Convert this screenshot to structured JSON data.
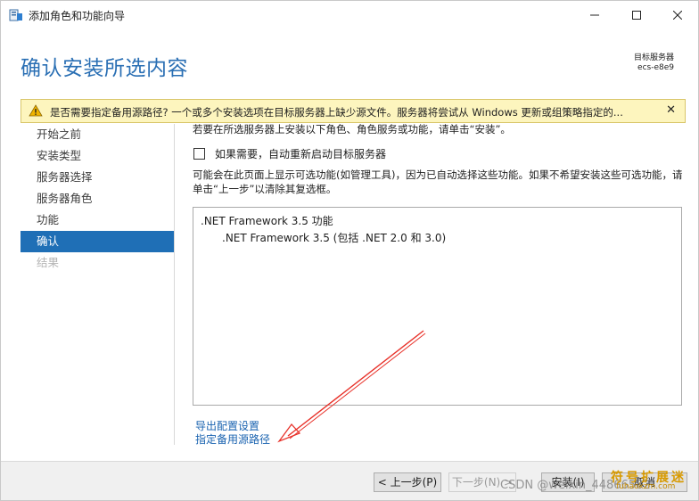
{
  "window": {
    "title": "添加角色和功能向导"
  },
  "header": {
    "page_title": "确认安装所选内容",
    "target_label": "目标服务器",
    "target_value": "ecs-e8e9"
  },
  "warning": {
    "text": "是否需要指定备用源路径? 一个或多个安装选项在目标服务器上缺少源文件。服务器将尝试从 Windows 更新或组策略指定的...",
    "close_glyph": "✕"
  },
  "nav": {
    "items": [
      {
        "label": "开始之前",
        "state": "normal"
      },
      {
        "label": "安装类型",
        "state": "normal"
      },
      {
        "label": "服务器选择",
        "state": "normal"
      },
      {
        "label": "服务器角色",
        "state": "normal"
      },
      {
        "label": "功能",
        "state": "normal"
      },
      {
        "label": "确认",
        "state": "active"
      },
      {
        "label": "结果",
        "state": "disabled"
      }
    ]
  },
  "content": {
    "intro": "若要在所选服务器上安装以下角色、角色服务或功能，请单击“安装”。",
    "restart_checkbox_label": "如果需要，自动重新启动目标服务器",
    "restart_checked": false,
    "note": "可能会在此页面上显示可选功能(如管理工具)，因为已自动选择这些功能。如果不希望安装这些可选功能，请单击“上一步”以清除其复选框。",
    "features": [
      ".NET Framework 3.5 功能",
      ".NET Framework 3.5 (包括 .NET 2.0 和 3.0)"
    ],
    "links": {
      "export": "导出配置设置",
      "alternate_source": "指定备用源路径"
    }
  },
  "footer": {
    "prev": "< 上一步(P)",
    "next": "下一步(N) >",
    "install": "安装(I)",
    "cancel": "取消"
  },
  "watermarks": {
    "csdn": "CSDN @weixin_44866582",
    "logo": "符号扩展迷",
    "url": "fuhaokzm.com"
  },
  "colors": {
    "title_blue": "#2a6fb4",
    "nav_active": "#1f6fb6",
    "warning_bg": "#fdf5be",
    "link": "#1a63b0",
    "annotation_arrow": "#e8322a"
  },
  "icons": {
    "app": "server-manager-icon",
    "warning": "warning-triangle-icon"
  }
}
